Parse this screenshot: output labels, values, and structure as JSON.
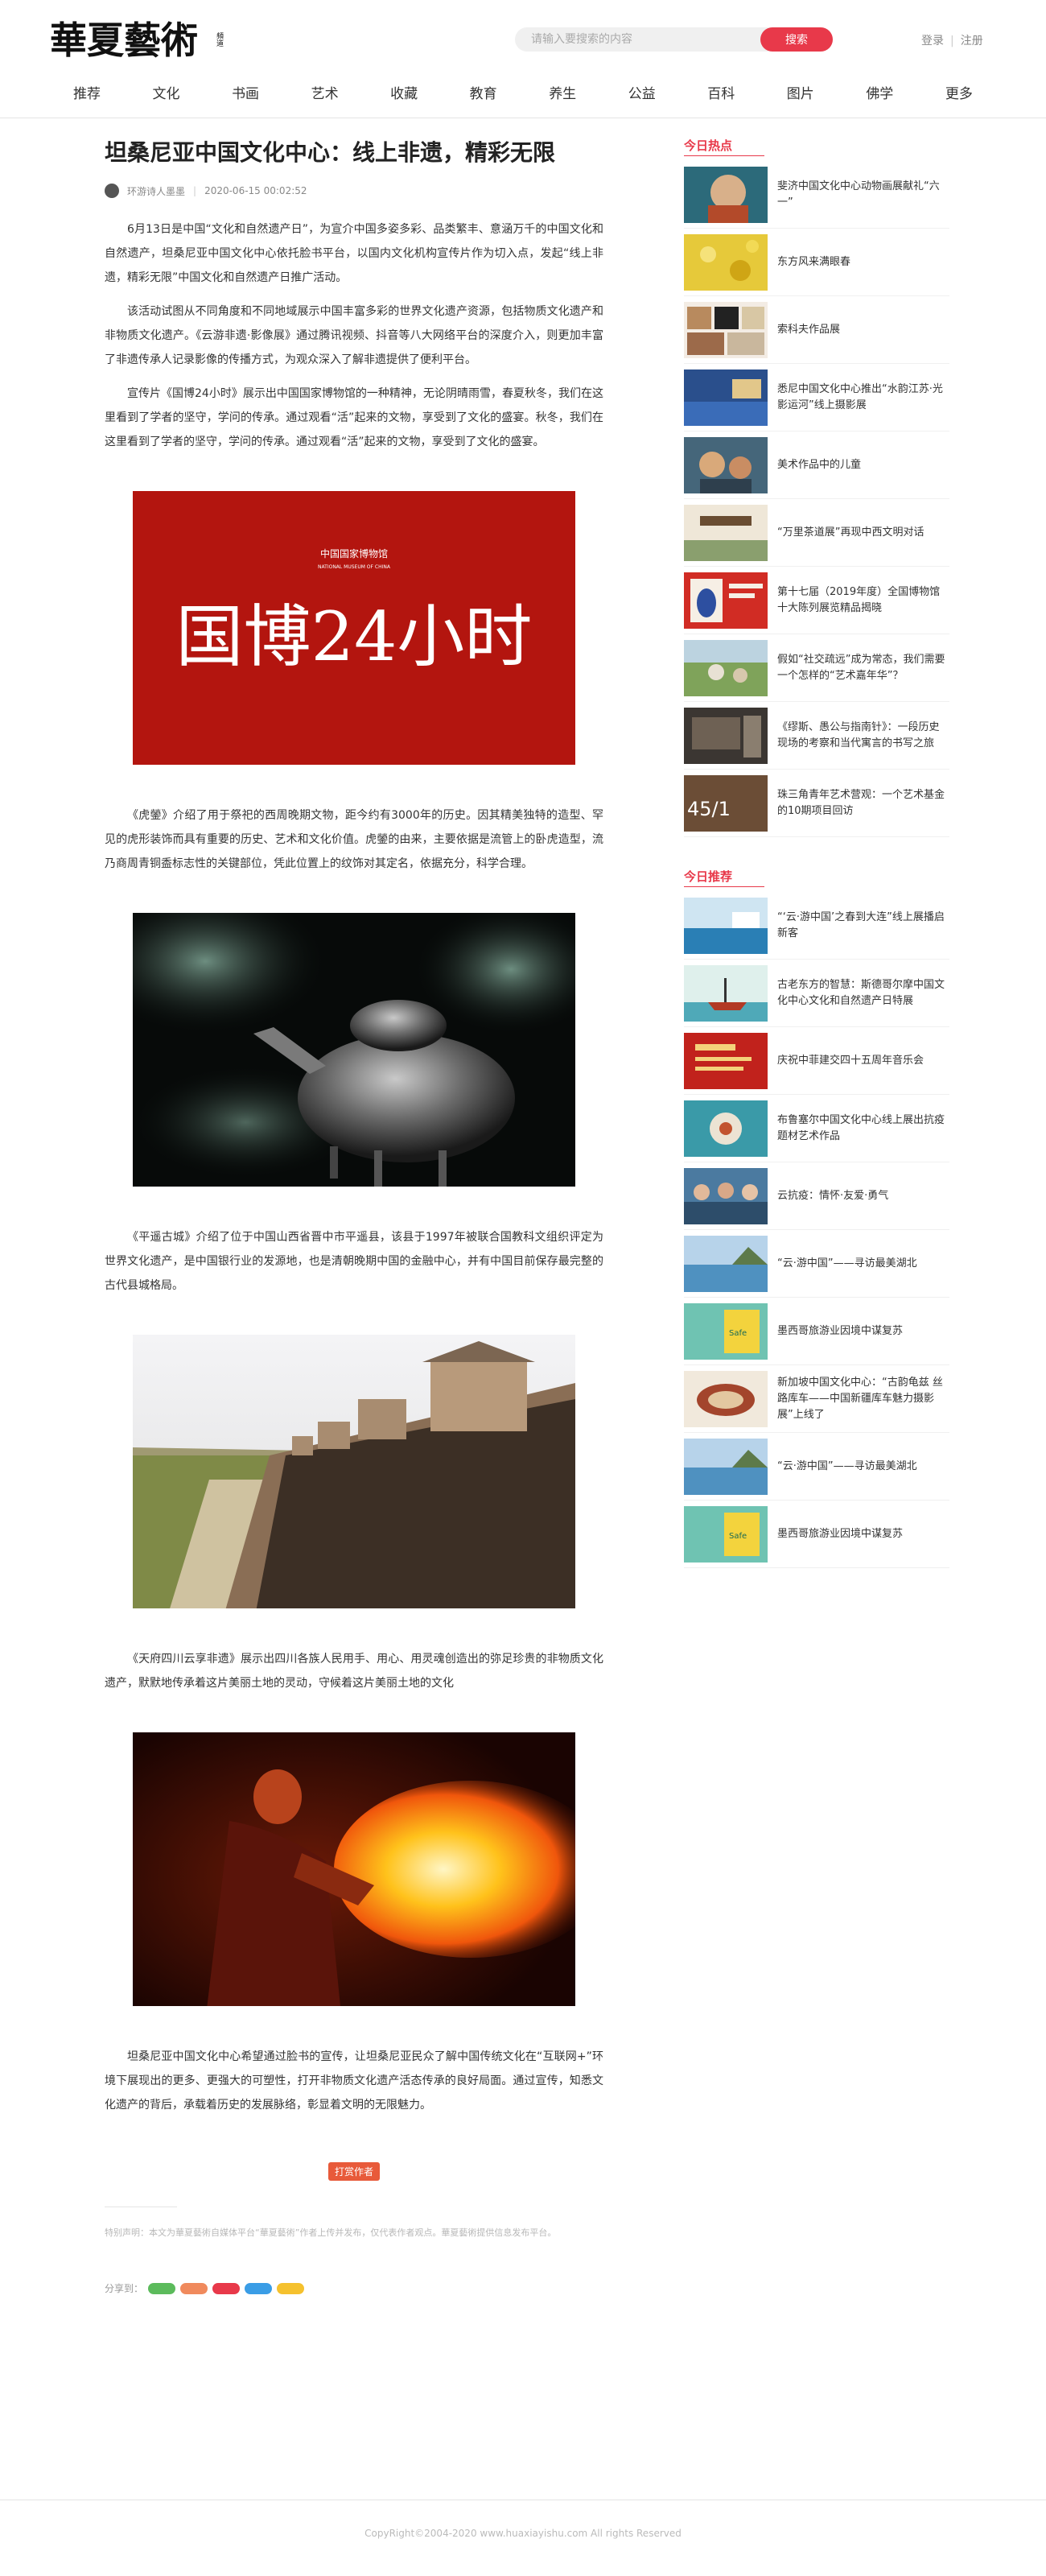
{
  "site": {
    "logo_text": "華夏藝術",
    "logo_sub": "頻道",
    "search_placeholder": "请输入要搜索的内容",
    "search_button": "搜索",
    "login": "登录",
    "register": "注册"
  },
  "nav": [
    "推荐",
    "文化",
    "书画",
    "艺术",
    "收藏",
    "教育",
    "养生",
    "公益",
    "百科",
    "图片",
    "佛学",
    "更多"
  ],
  "article": {
    "title": "坦桑尼亚中国文化中心：线上非遗，精彩无限",
    "author": "环游诗人墨墨",
    "date": "2020-06-15 00:02:52",
    "p1": "6月13日是中国“文化和自然遗产日”，为宣介中国多姿多彩、品类繁丰、意涵万千的中国文化和自然遗产，坦桑尼亚中国文化中心依托脸书平台，以国内文化机构宣传片作为切入点，发起“线上非遗，精彩无限”中国文化和自然遗产日推广活动。",
    "p2": "该活动试图从不同角度和不同地域展示中国丰富多彩的世界文化遗产资源，包括物质文化遗产和非物质文化遗产。《云游非遗·影像展》通过腾讯视频、抖音等八大网络平台的深度介入，则更加丰富了非遗传承人记录影像的传播方式，为观众深入了解非遗提供了便利平台。",
    "p3": "宣传片《国博24小时》展示出中国国家博物馆的一种精神，无论阴晴雨雪，春夏秋冬，我们在这里看到了学者的坚守，学问的传承。通过观看“活”起来的文物，享受到了文化的盛宴。秋冬，我们在这里看到了学者的坚守，学问的传承。通过观看“活”起来的文物，享受到了文化的盛宴。",
    "img1_small": "中国国家博物馆",
    "img1_small_en": "NATIONAL MUSEUM OF CHINA",
    "img1_big": "国博24小时",
    "p4": "《虎鎣》介绍了用于祭祀的西周晚期文物，距今约有3000年的历史。因其精美独特的造型、罕见的虎形装饰而具有重要的历史、艺术和文化价值。虎鎣的由来，主要依据是流管上的卧虎造型，流乃商周青铜盉标志性的关键部位，凭此位置上的纹饰对其定名，依据充分，科学合理。",
    "p5": "《平遥古城》介绍了位于中国山西省晋中市平遥县，该县于1997年被联合国教科文组织评定为世界文化遗产，是中国银行业的发源地，也是清朝晚期中国的金融中心，并有中国目前保存最完整的古代县城格局。",
    "p6": "《天府四川云享非遗》展示出四川各族人民用手、用心、用灵魂创造出的弥足珍贵的非物质文化遗产，默默地传承着这片美丽土地的灵动，守候着这片美丽土地的文化",
    "p7": "坦桑尼亚中国文化中心希望通过脸书的宣传，让坦桑尼亚民众了解中国传统文化在“互联网+”环境下展现出的更多、更强大的可塑性，打开非物质文化遗产活态传承的良好局面。通过宣传，知悉文化遗产的背后，承载着历史的发展脉络，彰显着文明的无限魅力。",
    "tip_button": "打赏作者",
    "declaration": "特别声明：本文为華夏藝術自媒体平台“華夏藝術”作者上传并发布，仅代表作者观点。華夏藝術提供信息发布平台。",
    "share_label": "分享到："
  },
  "sidebar": {
    "hot_title": "今日热点",
    "hot": [
      {
        "title": "斐济中国文化中心动物画展献礼“六一”",
        "thumb": "portrait"
      },
      {
        "title": "东方风来满眼春",
        "thumb": "yellow"
      },
      {
        "title": "索科夫作品展",
        "thumb": "collage"
      },
      {
        "title": "悉尼中国文化中心推出“水韵江苏·光影运河”线上摄影展",
        "thumb": "blue"
      },
      {
        "title": "美术作品中的儿童",
        "thumb": "painting"
      },
      {
        "title": "“万里茶道展”再现中西文明对话",
        "thumb": "tea"
      },
      {
        "title": "第十七届（2019年度）全国博物馆十大陈列展览精品揭晓",
        "thumb": "porcelain"
      },
      {
        "title": "假如“社交疏远”成为常态，我们需要一个怎样的“艺术嘉年华”？",
        "thumb": "outdoor"
      },
      {
        "title": "《缪斯、愚公与指南针》：一段历史现场的考察和当代寓言的书写之旅",
        "thumb": "room"
      },
      {
        "title": "珠三角青年艺术营观：一个艺术基金的10期项目回访",
        "thumb": "number"
      }
    ],
    "rec_title": "今日推荐",
    "rec": [
      {
        "title": "“‘云·游中国’之春到大连”线上展播启新客",
        "thumb": "sea"
      },
      {
        "title": "古老东方的智慧：斯德哥尔摩中国文化中心文化和自然遗产日特展",
        "thumb": "ship"
      },
      {
        "title": "庆祝中菲建交四十五周年音乐会",
        "thumb": "red"
      },
      {
        "title": "布鲁塞尔中国文化中心线上展出抗疫题材艺术作品",
        "thumb": "teal"
      },
      {
        "title": "云抗疫：情怀·友爱·勇气",
        "thumb": "people"
      },
      {
        "title": "“云·游中国”——寻访最美湖北",
        "thumb": "lake"
      },
      {
        "title": "墨西哥旅游业因境中谋复苏",
        "thumb": "poster"
      },
      {
        "title": "新加坡中国文化中心：“古韵龟兹 丝路库车——中国新疆库车魅力摄影展”上线了",
        "thumb": "plate"
      },
      {
        "title": "“云·游中国”——寻访最美湖北",
        "thumb": "lake"
      },
      {
        "title": "墨西哥旅游业因境中谋复苏",
        "thumb": "poster"
      }
    ]
  },
  "footer": "CopyRight©2004-2020 www.huaxiayishu.com All rights Reserved"
}
